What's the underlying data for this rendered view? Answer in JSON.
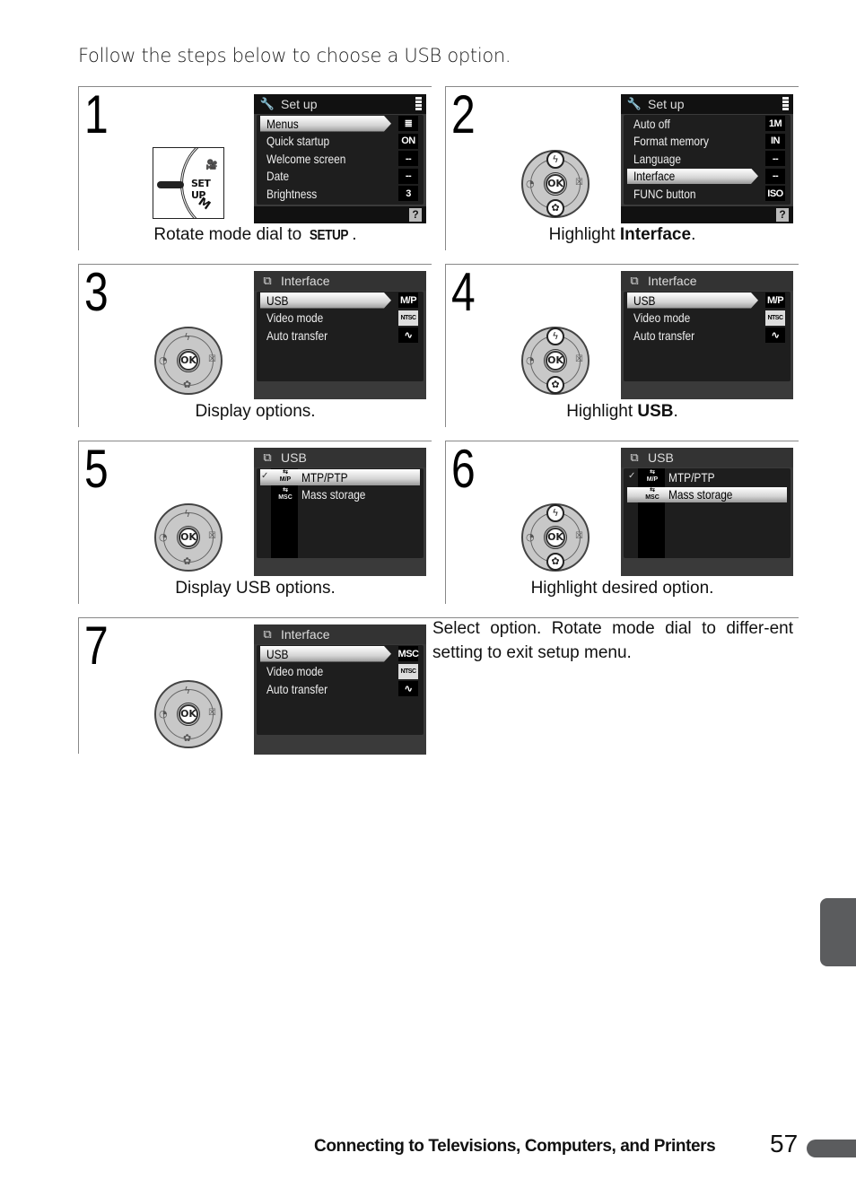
{
  "intro": "Follow the steps below to choose a USB option.",
  "steps": [
    {
      "number": "1",
      "caption_pre": "Rotate mode dial to ",
      "caption_bold": "SETUP",
      "caption_post": ".",
      "control": "mode-dial",
      "dial_label": "SET UP",
      "dial_m": "M",
      "screen": {
        "title": "Set up",
        "title_icon": "wrench-icon",
        "rows": [
          {
            "label": "Menus",
            "value": "≣",
            "selected": true
          },
          {
            "label": "Quick startup",
            "value": "ON"
          },
          {
            "label": "Welcome screen",
            "value": "--"
          },
          {
            "label": "Date",
            "value": "--"
          },
          {
            "label": "Brightness",
            "value": "3"
          }
        ],
        "help": "?"
      }
    },
    {
      "number": "2",
      "caption_pre": "Highlight ",
      "caption_bold": "Interface",
      "caption_post": ".",
      "control": "multi-selector-updown",
      "screen": {
        "title": "Set up",
        "title_icon": "wrench-icon",
        "rows": [
          {
            "label": "Auto off",
            "value": "1M"
          },
          {
            "label": "Format memory",
            "value": "IN"
          },
          {
            "label": "Language",
            "value": "--"
          },
          {
            "label": "Interface",
            "value": "--",
            "selected": true
          },
          {
            "label": "FUNC button",
            "value": "ISO"
          }
        ],
        "help": "?"
      }
    },
    {
      "number": "3",
      "caption_pre": "Display options.",
      "caption_bold": "",
      "caption_post": "",
      "control": "multi-selector-ok",
      "screen": {
        "title": "Interface",
        "rows": [
          {
            "label": "USB",
            "value": "M/P",
            "selected": true
          },
          {
            "label": "Video mode",
            "value": "NTSC"
          },
          {
            "label": "Auto transfer",
            "value": "∿"
          }
        ]
      }
    },
    {
      "number": "4",
      "caption_pre": "Highlight ",
      "caption_bold": "USB",
      "caption_post": ".",
      "control": "multi-selector-updown",
      "screen": {
        "title": "Interface",
        "rows": [
          {
            "label": "USB",
            "value": "M/P",
            "selected": true
          },
          {
            "label": "Video mode",
            "value": "NTSC"
          },
          {
            "label": "Auto transfer",
            "value": "∿"
          }
        ]
      }
    },
    {
      "number": "5",
      "caption_pre": "Display USB options.",
      "caption_bold": "",
      "caption_post": "",
      "control": "multi-selector-ok",
      "screen": {
        "title": "USB",
        "rows": [
          {
            "label": "MTP/PTP",
            "icon": "M/P",
            "checked": true,
            "selected": true
          },
          {
            "label": "Mass storage",
            "icon": "MSC"
          }
        ]
      }
    },
    {
      "number": "6",
      "caption_pre": "Highlight desired option.",
      "caption_bold": "",
      "caption_post": "",
      "control": "multi-selector-updown",
      "screen": {
        "title": "USB",
        "rows": [
          {
            "label": "MTP/PTP",
            "icon": "M/P",
            "checked": true
          },
          {
            "label": "Mass storage",
            "icon": "MSC",
            "selected": true
          }
        ]
      }
    },
    {
      "number": "7",
      "text": "Select option.  Rotate mode dial to differ-ent setting to exit setup menu.",
      "control": "multi-selector-ok",
      "screen": {
        "title": "Interface",
        "rows": [
          {
            "label": "USB",
            "value": "MSC",
            "selected": true
          },
          {
            "label": "Video mode",
            "value": "NTSC"
          },
          {
            "label": "Auto transfer",
            "value": "∿"
          }
        ]
      }
    }
  ],
  "dial": {
    "ok": "OK",
    "up": "ϟ",
    "down": "✿",
    "left": "◔",
    "right": "☒"
  },
  "footer": {
    "section": "Connecting to Televisions, Computers, and Printers",
    "page": "57"
  }
}
